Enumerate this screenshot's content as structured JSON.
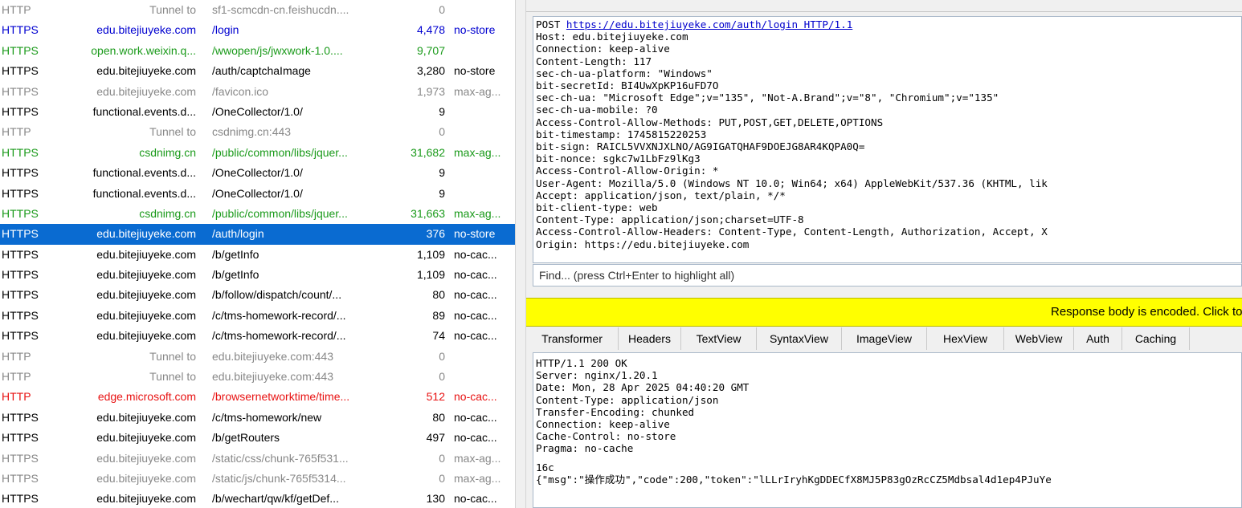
{
  "sessions": [
    {
      "protocol": "HTTP",
      "host": "Tunnel to",
      "url": "sf1-scmcdn-cn.feishucdn....",
      "body": "0",
      "caching": "",
      "style": "dim"
    },
    {
      "protocol": "HTTPS",
      "host": "edu.bitejiuyeke.com",
      "url": "/login",
      "body": "4,478",
      "caching": "no-store",
      "style": "blue"
    },
    {
      "protocol": "HTTPS",
      "host": "open.work.weixin.q...",
      "url": "/wwopen/js/jwxwork-1.0....",
      "body": "9,707",
      "caching": "",
      "style": "green"
    },
    {
      "protocol": "HTTPS",
      "host": "edu.bitejiuyeke.com",
      "url": "/auth/captchaImage",
      "body": "3,280",
      "caching": "no-store",
      "style": "normal"
    },
    {
      "protocol": "HTTPS",
      "host": "edu.bitejiuyeke.com",
      "url": "/favicon.ico",
      "body": "1,973",
      "caching": "max-ag...",
      "style": "dim"
    },
    {
      "protocol": "HTTPS",
      "host": "functional.events.d...",
      "url": "/OneCollector/1.0/",
      "body": "9",
      "caching": "",
      "style": "normal"
    },
    {
      "protocol": "HTTP",
      "host": "Tunnel to",
      "url": "csdnimg.cn:443",
      "body": "0",
      "caching": "",
      "style": "dim"
    },
    {
      "protocol": "HTTPS",
      "host": "csdnimg.cn",
      "url": "/public/common/libs/jquer...",
      "body": "31,682",
      "caching": "max-ag...",
      "style": "green"
    },
    {
      "protocol": "HTTPS",
      "host": "functional.events.d...",
      "url": "/OneCollector/1.0/",
      "body": "9",
      "caching": "",
      "style": "normal"
    },
    {
      "protocol": "HTTPS",
      "host": "functional.events.d...",
      "url": "/OneCollector/1.0/",
      "body": "9",
      "caching": "",
      "style": "normal"
    },
    {
      "protocol": "HTTPS",
      "host": "csdnimg.cn",
      "url": "/public/common/libs/jquer...",
      "body": "31,663",
      "caching": "max-ag...",
      "style": "green"
    },
    {
      "protocol": "HTTPS",
      "host": "edu.bitejiuyeke.com",
      "url": "/auth/login",
      "body": "376",
      "caching": "no-store",
      "style": "selected"
    },
    {
      "protocol": "HTTPS",
      "host": "edu.bitejiuyeke.com",
      "url": "/b/getInfo",
      "body": "1,109",
      "caching": "no-cac...",
      "style": "normal"
    },
    {
      "protocol": "HTTPS",
      "host": "edu.bitejiuyeke.com",
      "url": "/b/getInfo",
      "body": "1,109",
      "caching": "no-cac...",
      "style": "normal"
    },
    {
      "protocol": "HTTPS",
      "host": "edu.bitejiuyeke.com",
      "url": "/b/follow/dispatch/count/...",
      "body": "80",
      "caching": "no-cac...",
      "style": "normal"
    },
    {
      "protocol": "HTTPS",
      "host": "edu.bitejiuyeke.com",
      "url": "/c/tms-homework-record/...",
      "body": "89",
      "caching": "no-cac...",
      "style": "normal"
    },
    {
      "protocol": "HTTPS",
      "host": "edu.bitejiuyeke.com",
      "url": "/c/tms-homework-record/...",
      "body": "74",
      "caching": "no-cac...",
      "style": "normal"
    },
    {
      "protocol": "HTTP",
      "host": "Tunnel to",
      "url": "edu.bitejiuyeke.com:443",
      "body": "0",
      "caching": "",
      "style": "dim"
    },
    {
      "protocol": "HTTP",
      "host": "Tunnel to",
      "url": "edu.bitejiuyeke.com:443",
      "body": "0",
      "caching": "",
      "style": "dim"
    },
    {
      "protocol": "HTTP",
      "host": "edge.microsoft.com",
      "url": "/browsernetworktime/time...",
      "body": "512",
      "caching": "no-cac...",
      "style": "red"
    },
    {
      "protocol": "HTTPS",
      "host": "edu.bitejiuyeke.com",
      "url": "/c/tms-homework/new",
      "body": "80",
      "caching": "no-cac...",
      "style": "normal"
    },
    {
      "protocol": "HTTPS",
      "host": "edu.bitejiuyeke.com",
      "url": "/b/getRouters",
      "body": "497",
      "caching": "no-cac...",
      "style": "normal"
    },
    {
      "protocol": "HTTPS",
      "host": "edu.bitejiuyeke.com",
      "url": "/static/css/chunk-765f531...",
      "body": "0",
      "caching": "max-ag...",
      "style": "dim"
    },
    {
      "protocol": "HTTPS",
      "host": "edu.bitejiuyeke.com",
      "url": "/static/js/chunk-765f5314...",
      "body": "0",
      "caching": "max-ag...",
      "style": "dim"
    },
    {
      "protocol": "HTTPS",
      "host": "edu.bitejiuyeke.com",
      "url": "/b/wechart/qw/kf/getDef...",
      "body": "130",
      "caching": "no-cac...",
      "style": "normal"
    }
  ],
  "request": {
    "method_prefix": "POST ",
    "url": "https://edu.bitejiuyeke.com/auth/login HTTP/1.1",
    "headers": [
      "Host: edu.bitejiuyeke.com",
      "Connection: keep-alive",
      "Content-Length: 117",
      "sec-ch-ua-platform: \"Windows\"",
      "bit-secretId: BI4UwXpKP16uFD7O",
      "sec-ch-ua: \"Microsoft Edge\";v=\"135\", \"Not-A.Brand\";v=\"8\", \"Chromium\";v=\"135\"",
      "sec-ch-ua-mobile: ?0",
      "Access-Control-Allow-Methods: PUT,POST,GET,DELETE,OPTIONS",
      "bit-timestamp: 1745815220253",
      "bit-sign: RAICL5VVXNJXLNO/AG9IGATQHAF9DOEJG8AR4KQPA0Q=",
      "bit-nonce: sgkc7w1LbFz9lKg3",
      "Access-Control-Allow-Origin: *",
      "User-Agent: Mozilla/5.0 (Windows NT 10.0; Win64; x64) AppleWebKit/537.36 (KHTML, lik",
      "Accept: application/json, text/plain, */*",
      "bit-client-type: web",
      "Content-Type: application/json;charset=UTF-8",
      "Access-Control-Allow-Headers: Content-Type, Content-Length, Authorization, Accept, X",
      "Origin: https://edu.bitejiuyeke.com"
    ]
  },
  "find": {
    "placeholder": "Find... (press Ctrl+Enter to highlight all)"
  },
  "warning": "Response body is encoded. Click to decode.",
  "tabs": [
    "Transformer",
    "Headers",
    "TextView",
    "SyntaxView",
    "ImageView",
    "HexView",
    "WebView",
    "Auth",
    "Caching"
  ],
  "response": {
    "headers": [
      "HTTP/1.1 200 OK",
      "Server: nginx/1.20.1",
      "Date: Mon, 28 Apr 2025 04:40:20 GMT",
      "Content-Type: application/json",
      "Transfer-Encoding: chunked",
      "Connection: keep-alive",
      "Cache-Control: no-store",
      "Pragma: no-cache"
    ],
    "chunk": "16c",
    "body": "{\"msg\":\"操作成功\",\"code\":200,\"token\":\"lLLrIryhKgDDECfX8MJ5P83gOzRcCZ5Mdbsal4d1ep4PJuYe"
  }
}
